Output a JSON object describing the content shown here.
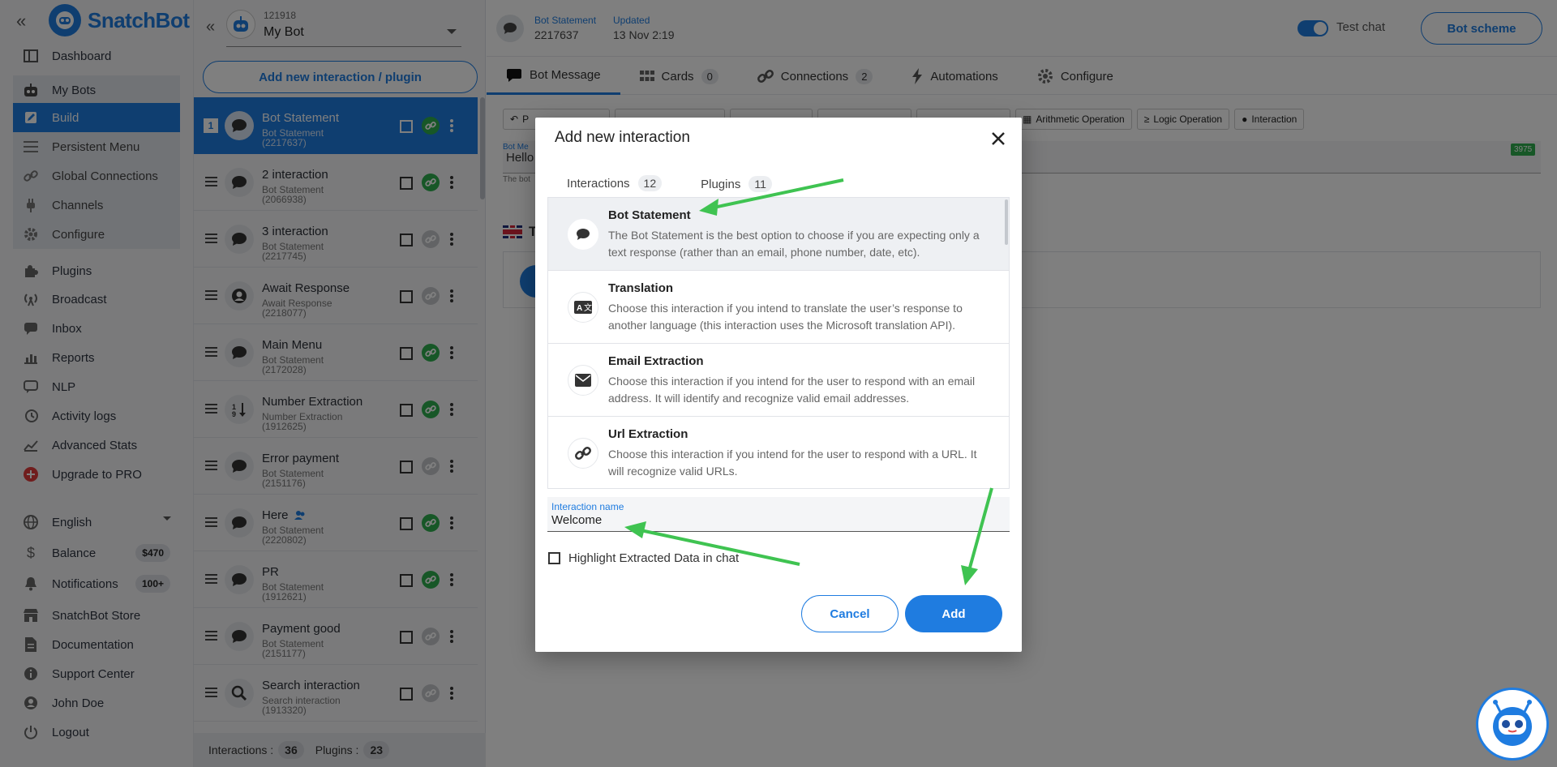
{
  "brand": {
    "name": "SnatchBot"
  },
  "nav": {
    "items": [
      {
        "label": "Dashboard",
        "icon": "dashboard-icon"
      },
      {
        "label": "My Bots",
        "icon": "robot-icon"
      },
      {
        "label": "Build",
        "icon": "pencil-icon"
      },
      {
        "label": "Persistent Menu",
        "icon": "menu-icon"
      },
      {
        "label": "Global Connections",
        "icon": "link-icon"
      },
      {
        "label": "Channels",
        "icon": "plug-icon"
      },
      {
        "label": "Configure",
        "icon": "gear-icon"
      },
      {
        "label": "Plugins",
        "icon": "puzzle-icon"
      },
      {
        "label": "Broadcast",
        "icon": "broadcast-icon"
      },
      {
        "label": "Inbox",
        "icon": "chat-icon"
      },
      {
        "label": "Reports",
        "icon": "bar-chart-icon"
      },
      {
        "label": "NLP",
        "icon": "nlp-chat-icon"
      },
      {
        "label": "Activity logs",
        "icon": "history-icon"
      },
      {
        "label": "Advanced Stats",
        "icon": "line-chart-icon"
      },
      {
        "label": "Upgrade to PRO",
        "icon": "upgrade-icon"
      },
      {
        "label": "English",
        "icon": "globe-icon"
      },
      {
        "label": "Balance",
        "icon": "dollar-icon",
        "badge": "$470"
      },
      {
        "label": "Notifications",
        "icon": "bell-icon",
        "badge": "100+"
      },
      {
        "label": "SnatchBot Store",
        "icon": "store-icon"
      },
      {
        "label": "Documentation",
        "icon": "document-icon"
      },
      {
        "label": "Support Center",
        "icon": "info-icon"
      },
      {
        "label": "John Doe",
        "icon": "user-icon"
      },
      {
        "label": "Logout",
        "icon": "power-icon"
      }
    ]
  },
  "bot": {
    "id": "121918",
    "name": "My Bot"
  },
  "list": {
    "add_label": "Add new interaction / plugin",
    "selected_index": "1",
    "items": [
      {
        "title": "Bot Statement",
        "sub": "Bot Statement (2217637)",
        "icon": "chat-bubble-icon",
        "linked": true
      },
      {
        "title": "2 interaction",
        "sub": "Bot Statement (2066938)",
        "icon": "chat-bubble-icon",
        "linked": true
      },
      {
        "title": "3 interaction",
        "sub": "Bot Statement (2217745)",
        "icon": "chat-bubble-icon",
        "linked": false
      },
      {
        "title": "Await Response",
        "sub": "Await Response (2218077)",
        "icon": "user-circle-icon",
        "linked": false
      },
      {
        "title": "Main Menu",
        "sub": "Bot Statement (2172028)",
        "icon": "chat-bubble-icon",
        "linked": true
      },
      {
        "title": "Number Extraction",
        "sub": "Number Extraction (1912625)",
        "icon": "number-sort-icon",
        "linked": true
      },
      {
        "title": "Error payment",
        "sub": "Bot Statement (2151176)",
        "icon": "chat-bubble-icon",
        "linked": false
      },
      {
        "title": "Here",
        "sub": "Bot Statement (2220802)",
        "icon": "chat-bubble-icon",
        "linked": true
      },
      {
        "title": "PR",
        "sub": "Bot Statement (1912621)",
        "icon": "chat-bubble-icon",
        "linked": true
      },
      {
        "title": "Payment good",
        "sub": "Bot Statement (2151177)",
        "icon": "chat-bubble-icon",
        "linked": false
      },
      {
        "title": "Search interaction",
        "sub": "Search interaction (1913320)",
        "icon": "search-icon",
        "linked": false
      }
    ],
    "footer": {
      "interactions_label": "Interactions :",
      "interactions_count": "36",
      "plugins_label": "Plugins :",
      "plugins_count": "23"
    }
  },
  "header": {
    "type_label": "Bot Statement",
    "id": "2217637",
    "updated_label": "Updated",
    "updated_value": "13 Nov 2:19",
    "test_chat_label": "Test chat",
    "bot_scheme_label": "Bot scheme"
  },
  "tabs": [
    {
      "label": "Bot Message",
      "icon": "message-icon"
    },
    {
      "label": "Cards",
      "count": "0",
      "icon": "grid-icon"
    },
    {
      "label": "Connections",
      "count": "2",
      "icon": "link-icon"
    },
    {
      "label": "Automations",
      "icon": "lightning-icon"
    },
    {
      "label": "Configure",
      "icon": "gear-icon"
    }
  ],
  "toolbar": {
    "items": [
      {
        "label": "P",
        "icon": "reply-icon"
      },
      {
        "label": "",
        "icon": ""
      },
      {
        "label": "",
        "icon": ""
      },
      {
        "label": "",
        "icon": ""
      },
      {
        "label": "",
        "icon": ""
      },
      {
        "label": "Arithmetic Operation",
        "icon": "calculator-icon"
      },
      {
        "label": "Logic Operation",
        "icon": "sigma-icon"
      },
      {
        "label": "Interaction",
        "icon": "chat-bubble-icon"
      }
    ]
  },
  "message": {
    "label": "Bot Me",
    "value": "Hello",
    "hint": "The bot",
    "char_count": "3975"
  },
  "language": {
    "label": "T"
  },
  "modal": {
    "title": "Add new interaction",
    "tabs": [
      {
        "label": "Interactions",
        "count": "12"
      },
      {
        "label": "Plugins",
        "count": "11"
      }
    ],
    "options": [
      {
        "title": "Bot Statement",
        "desc": "The Bot Statement is the best option to choose if you are expecting only a text response (rather than an email, phone number, date, etc).",
        "icon": "chat-bubble-icon"
      },
      {
        "title": "Translation",
        "desc": "Choose this interaction if you intend to translate the user’s response to another language (this interaction uses the Microsoft translation API).",
        "icon": "translate-icon"
      },
      {
        "title": "Email Extraction",
        "desc": "Choose this interaction if you intend for the user to respond with an email address. It will identify and recognize valid email addresses.",
        "icon": "envelope-icon"
      },
      {
        "title": "Url Extraction",
        "desc": "Choose this interaction if you intend for the user to respond with a URL. It will recognize valid URLs.",
        "icon": "link-icon"
      }
    ],
    "name_label": "Interaction name",
    "name_value": "Welcome",
    "highlight_label": "Highlight Extracted Data in chat",
    "cancel_label": "Cancel",
    "add_label": "Add"
  },
  "colors": {
    "accent": "#1f7ce0",
    "success": "#2eae4e",
    "annotation": "#3fc351"
  }
}
